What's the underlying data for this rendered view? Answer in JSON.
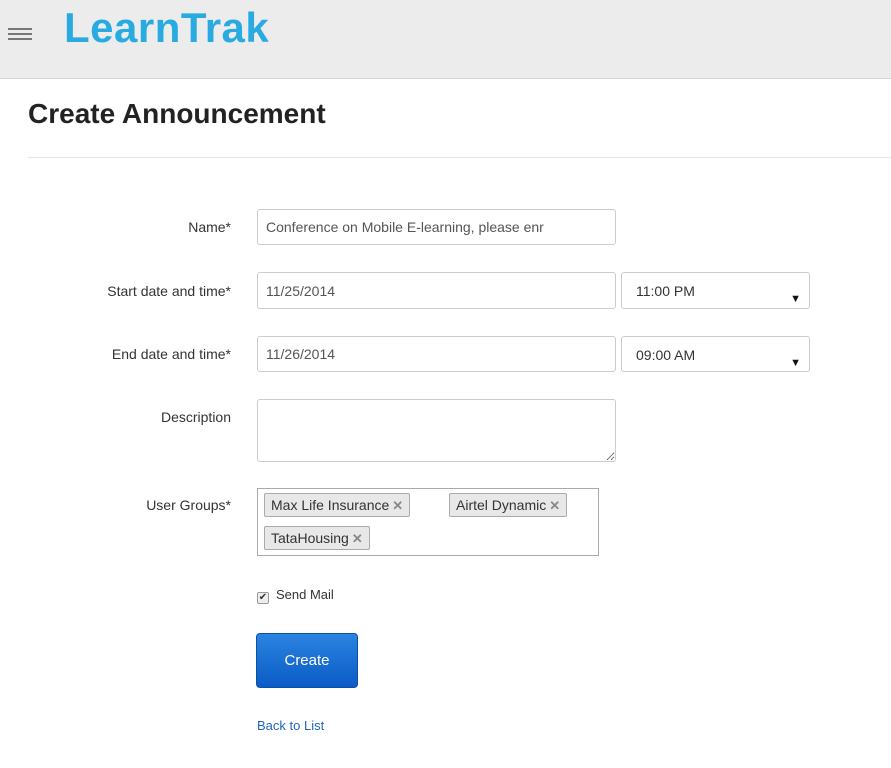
{
  "header": {
    "logo": "LearnTrak",
    "menu_icon": "hamburger-icon"
  },
  "page": {
    "title": "Create Announcement"
  },
  "form": {
    "name_label": "Name*",
    "name_value": "Conference on Mobile E-learning, please enr",
    "start_label": "Start date and time*",
    "start_date": "11/25/2014",
    "start_time": "11:00 PM",
    "end_label": "End date and time*",
    "end_date": "11/26/2014",
    "end_time": "09:00 AM",
    "description_label": "Description",
    "description_value": "",
    "groups_label": "User Groups*",
    "groups": [
      "Max Life Insurance",
      "Airtel Dynamic",
      "TataHousing"
    ],
    "remove_icon": "close-icon",
    "send_mail_label": "Send Mail",
    "send_mail_checked": true,
    "create_label": "Create",
    "back_label": "Back to List"
  },
  "colors": {
    "brand": "#29abe2",
    "button": "#0b5bc6",
    "link": "#2266bb"
  }
}
